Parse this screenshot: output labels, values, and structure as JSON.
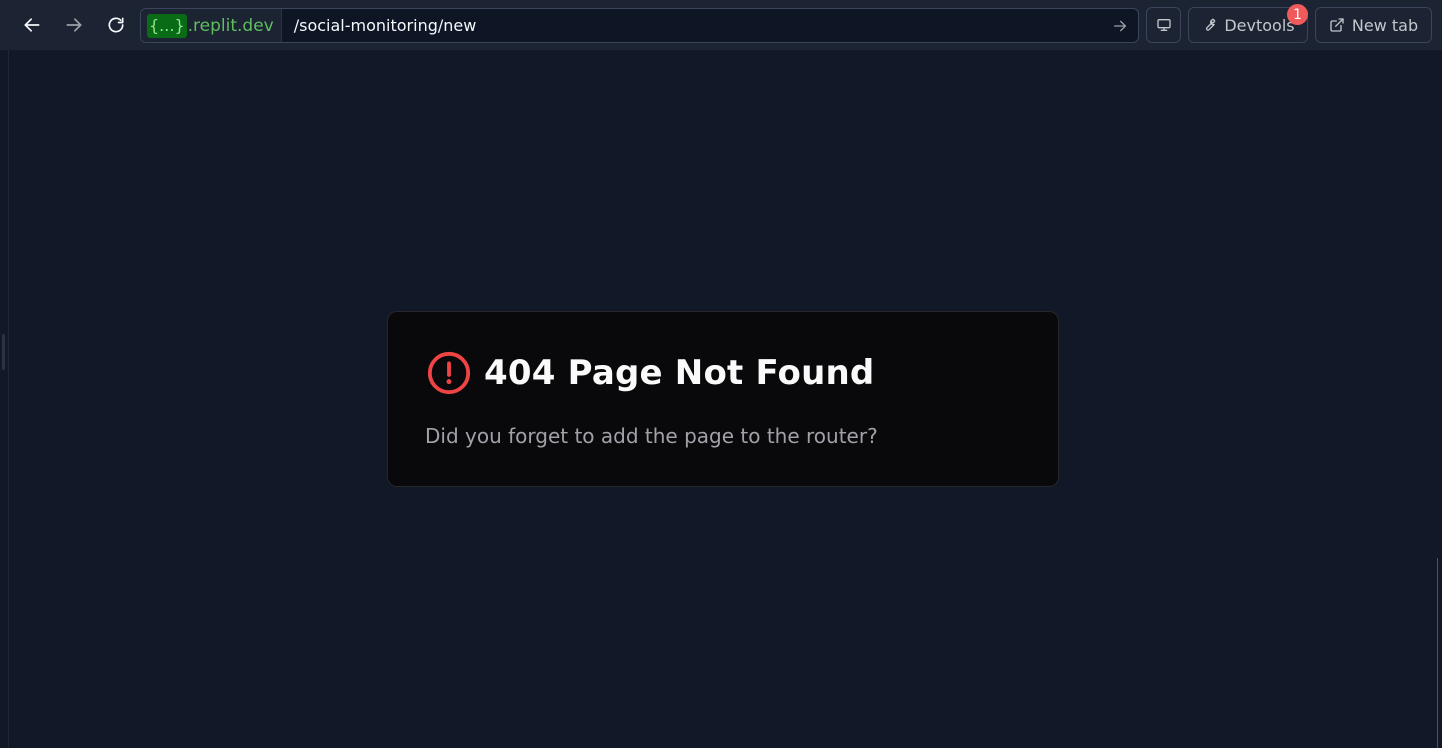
{
  "browser": {
    "url_domain_badge": "{...}",
    "url_domain_text": ".replit.dev",
    "url_path": "/social-monitoring/new",
    "buttons": {
      "devtools_label": "Devtools",
      "devtools_notification_count": "1",
      "new_tab_label": "New tab"
    }
  },
  "icons": {
    "back": "arrow-left-icon",
    "forward": "arrow-right-icon",
    "reload": "reload-icon",
    "go": "arrow-right-icon",
    "screen": "monitor-icon",
    "devtools": "wrench-icon",
    "new_tab": "external-link-icon",
    "alert": "alert-circle-icon"
  },
  "page": {
    "title": "404 Page Not Found",
    "message": "Did you forget to add the page to the router?"
  },
  "colors": {
    "background": "#111827",
    "card_background": "#09090b",
    "alert_red": "#ef4444",
    "domain_green": "#5fbf5f",
    "notification_red": "#f05a5a"
  }
}
